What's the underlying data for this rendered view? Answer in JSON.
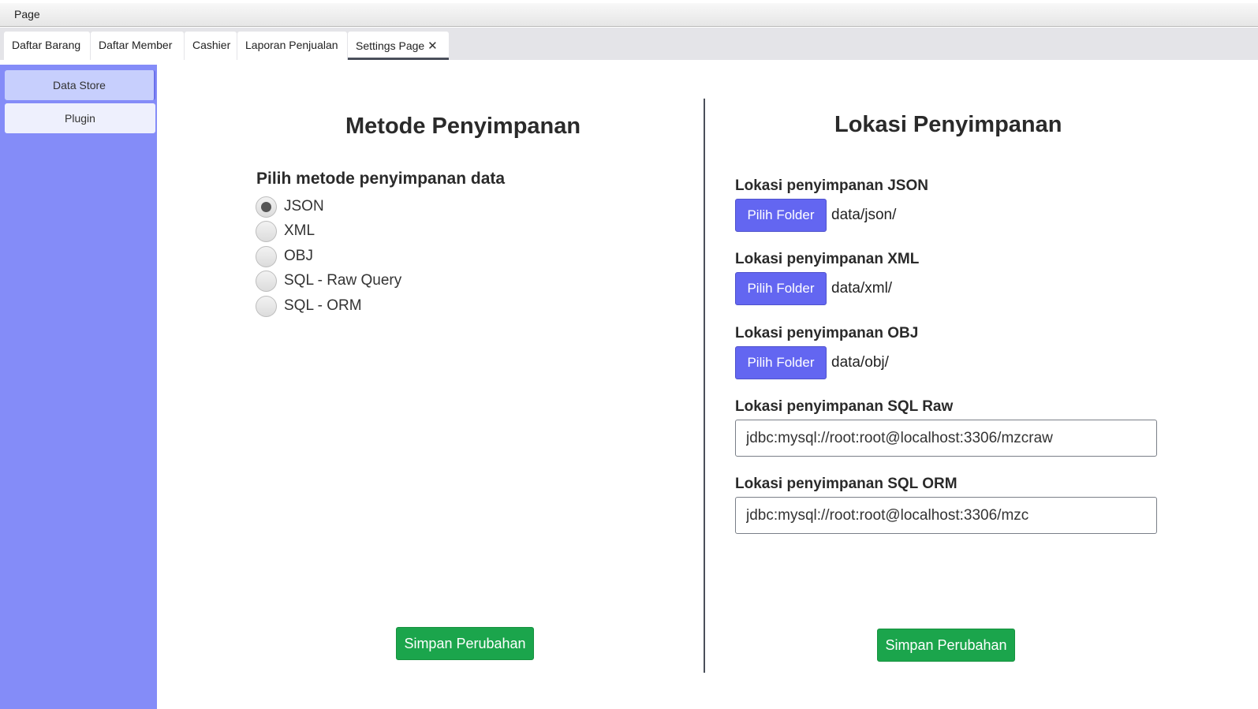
{
  "menubar": {
    "items": [
      "Page"
    ]
  },
  "tabs": [
    {
      "label": "Daftar Barang",
      "active": false
    },
    {
      "label": "Daftar Member",
      "active": false
    },
    {
      "label": "Cashier",
      "active": false
    },
    {
      "label": "Laporan Penjualan",
      "active": false
    },
    {
      "label": "Settings Page",
      "active": true,
      "close_icon": "✕"
    }
  ],
  "sidebar": {
    "items": [
      {
        "label": "Data Store",
        "active": true
      },
      {
        "label": "Plugin",
        "active": false
      }
    ]
  },
  "left_panel": {
    "title": "Metode Penyimpanan",
    "subtitle": "Pilih metode penyimpanan data",
    "options": [
      {
        "label": "JSON",
        "selected": true
      },
      {
        "label": "XML",
        "selected": false
      },
      {
        "label": "OBJ",
        "selected": false
      },
      {
        "label": "SQL - Raw Query",
        "selected": false
      },
      {
        "label": "SQL - ORM",
        "selected": false
      }
    ],
    "save_label": "Simpan Perubahan"
  },
  "right_panel": {
    "title": "Lokasi Penyimpanan",
    "json": {
      "label": "Lokasi penyimpanan JSON",
      "button": "Pilih Folder",
      "path": "data/json/"
    },
    "xml": {
      "label": "Lokasi penyimpanan XML",
      "button": "Pilih Folder",
      "path": "data/xml/"
    },
    "obj": {
      "label": "Lokasi penyimpanan OBJ",
      "button": "Pilih Folder",
      "path": "data/obj/"
    },
    "sql_raw": {
      "label": "Lokasi penyimpanan SQL Raw",
      "value": "jdbc:mysql://root:root@localhost:3306/mzcraw"
    },
    "sql_orm": {
      "label": "Lokasi penyimpanan SQL ORM",
      "value": "jdbc:mysql://root:root@localhost:3306/mzc"
    },
    "save_label": "Simpan Perubahan"
  },
  "colors": {
    "sidebar_bg": "#848cf8",
    "folder_button": "#6366f1",
    "save_button": "#1ba54c"
  }
}
